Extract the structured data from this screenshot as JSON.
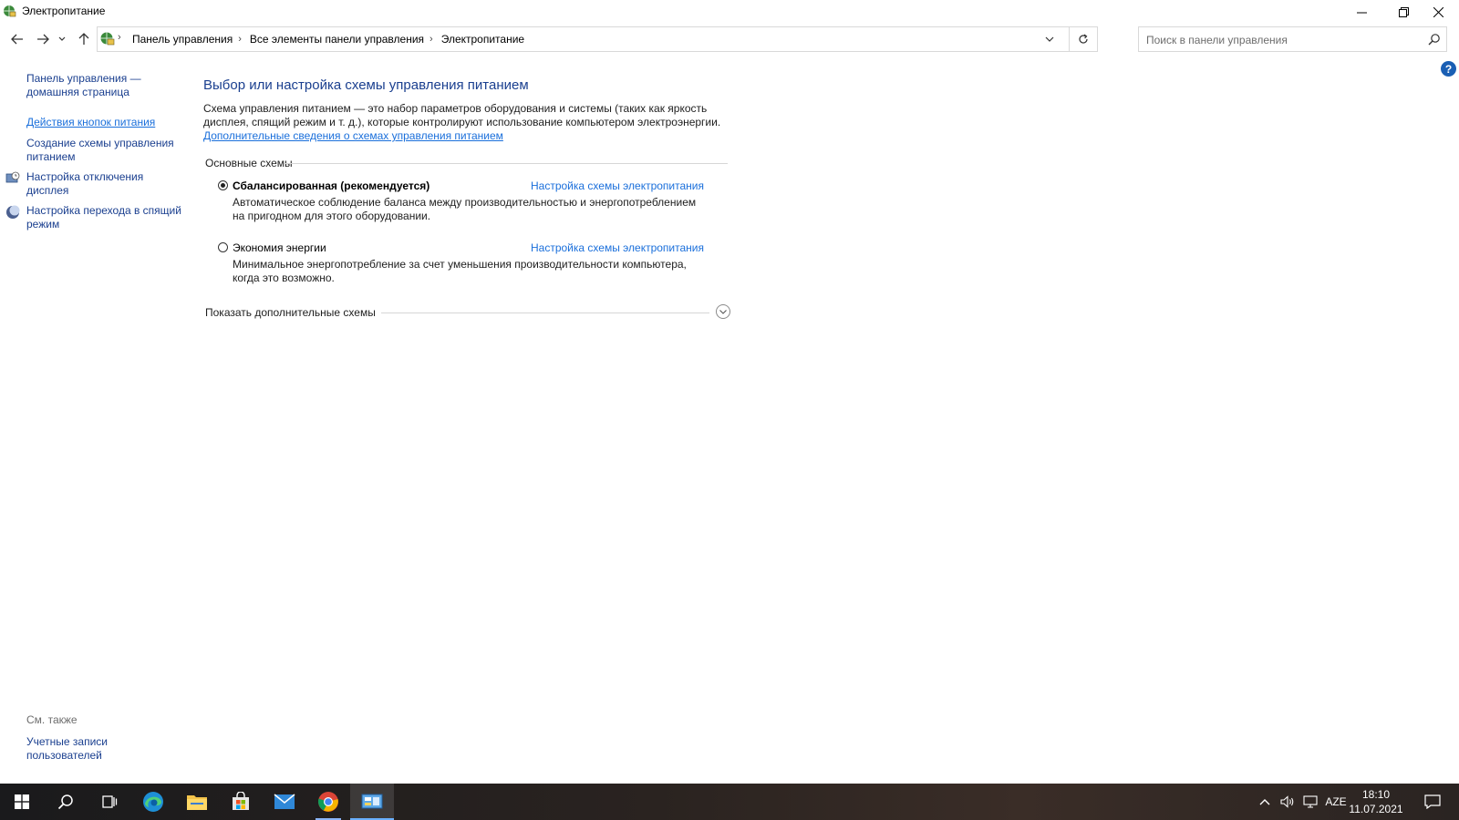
{
  "window": {
    "title": "Электропитание"
  },
  "address": {
    "crumbs": [
      "Панель управления",
      "Все элементы панели управления",
      "Электропитание"
    ]
  },
  "search": {
    "placeholder": "Поиск в панели управления"
  },
  "help_label": "?",
  "left_pane": {
    "home": "Панель управления — домашняя страница",
    "links": [
      {
        "label": "Действия кнопок питания",
        "icon": "none"
      },
      {
        "label": "Создание схемы управления питанием",
        "icon": "none"
      },
      {
        "label": "Настройка отключения дисплея",
        "icon": "display-clock-icon"
      },
      {
        "label": "Настройка перехода в спящий режим",
        "icon": "moon-icon"
      }
    ],
    "see_also": "См. также",
    "see_also_links": [
      "Учетные записи пользователей"
    ]
  },
  "main": {
    "heading": "Выбор или настройка схемы управления питанием",
    "description": "Схема управления питанием — это набор параметров оборудования и системы (таких как яркость дисплея, спящий режим и т. д.), которые контролируют использование компьютером электроэнергии.",
    "more_link": "Дополнительные сведения о схемах управления питанием",
    "group_label": "Основные схемы",
    "plans": [
      {
        "name": "Сбалансированная (рекомендуется)",
        "selected": true,
        "configure": "Настройка схемы электропитания",
        "description": "Автоматическое соблюдение баланса между производительностью и энергопотреблением на пригодном для этого оборудовании."
      },
      {
        "name": "Экономия энергии",
        "selected": false,
        "configure": "Настройка схемы электропитания",
        "description": "Минимальное энергопотребление за счет уменьшения производительности компьютера, когда это возможно."
      }
    ],
    "show_more": "Показать дополнительные схемы"
  },
  "taskbar": {
    "apps": [
      "windows-start-icon",
      "search-icon",
      "task-view-icon",
      "edge-icon",
      "file-explorer-icon",
      "store-icon",
      "mail-icon",
      "chrome-icon",
      "control-panel-icon"
    ],
    "language": "AZE",
    "time": "18:10",
    "date": "11.07.2021"
  },
  "colors": {
    "link": "#1a6fdb",
    "heading": "#1a3f8f",
    "accent": "#6ab0ff"
  }
}
